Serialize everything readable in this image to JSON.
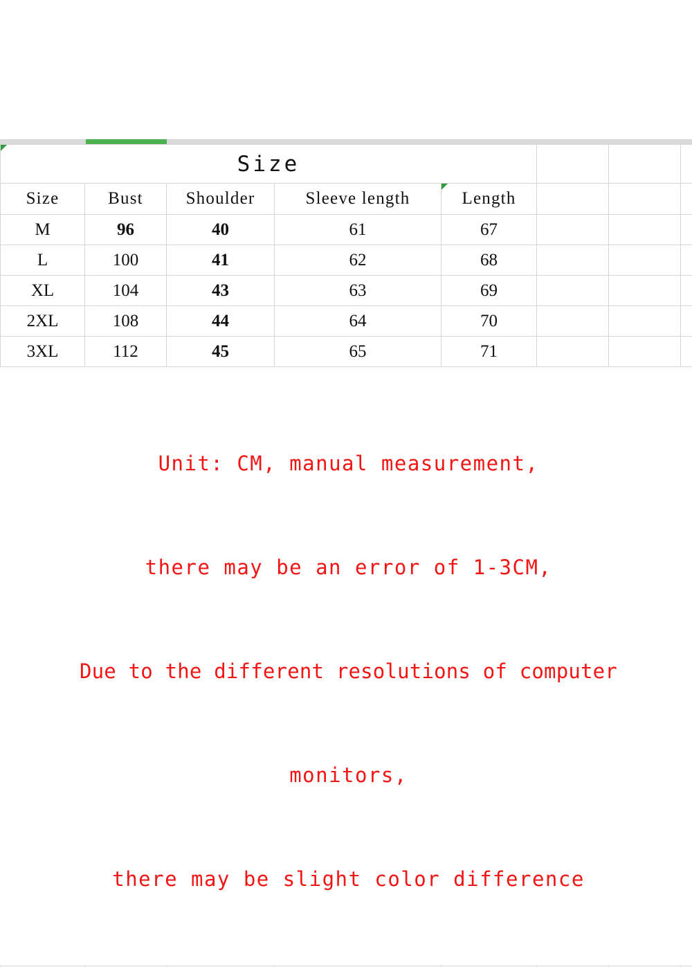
{
  "sheet": {
    "selected_column_marker": "bust-column-selected",
    "accent_green": "#4caf50",
    "note_red": "#f31414",
    "grid_line": "#d6d6d6"
  },
  "table": {
    "title": "Size",
    "columns": [
      "Size",
      "Bust",
      "Shoulder",
      "Sleeve length",
      "Length"
    ],
    "empty_columns": [
      "",
      "",
      ""
    ],
    "rows": [
      {
        "size": "M",
        "bust": "96",
        "shoulder": "40",
        "sleeve": "61",
        "length": "67"
      },
      {
        "size": "L",
        "bust": "100",
        "shoulder": "41",
        "sleeve": "62",
        "length": "68"
      },
      {
        "size": "XL",
        "bust": "104",
        "shoulder": "43",
        "sleeve": "63",
        "length": "69"
      },
      {
        "size": "2XL",
        "bust": "108",
        "shoulder": "44",
        "sleeve": "64",
        "length": "70"
      },
      {
        "size": "3XL",
        "bust": "112",
        "shoulder": "45",
        "sleeve": "65",
        "length": "71"
      }
    ]
  },
  "note": {
    "line1": "Unit: CM, manual measurement,",
    "line2": "there may be an error of 1-3CM,",
    "line3": "Due to the different resolutions of computer",
    "line4": "monitors,",
    "line5": "there may be slight color difference"
  },
  "chart_data": {
    "type": "table",
    "title": "Size",
    "columns": [
      "Size",
      "Bust",
      "Shoulder",
      "Sleeve length",
      "Length"
    ],
    "units": "CM",
    "rows": [
      [
        "M",
        96,
        40,
        61,
        67
      ],
      [
        "L",
        100,
        41,
        62,
        68
      ],
      [
        "XL",
        104,
        43,
        63,
        69
      ],
      [
        "2XL",
        108,
        44,
        64,
        70
      ],
      [
        "3XL",
        112,
        45,
        65,
        71
      ]
    ],
    "notes": [
      "Unit: CM, manual measurement,",
      "there may be an error of 1-3CM,",
      "Due to the different resolutions of computer",
      "monitors,",
      "there may be slight color difference"
    ]
  }
}
